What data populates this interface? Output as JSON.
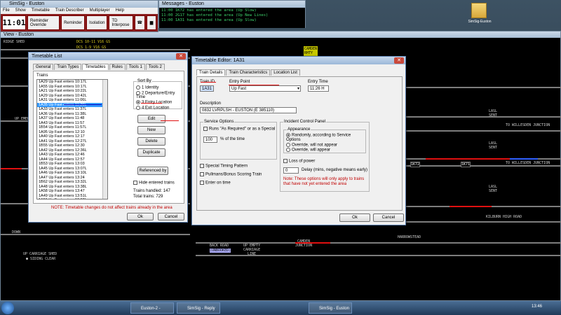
{
  "control": {
    "title": "SimSig - Euston",
    "menu": [
      "File",
      "Show",
      "Timetable",
      "Train Describer",
      "Multiplayer",
      "Help"
    ],
    "clock": "11:01",
    "buttons": [
      "Reminder Override",
      "Reminder",
      "Isolation",
      "TD Interpose"
    ]
  },
  "messages": {
    "title": "Messages - Euston",
    "lines": [
      "11:00 1K72 has entered the area (Up Slow)",
      "11:00 2G17 has entered the area (Up New Lines)",
      "11:00 1A31 has entered the area (Up Slow)"
    ]
  },
  "view": {
    "title": "View - Euston",
    "labels": {
      "sidings": "RIDGE SHED",
      "dcs1": "DCS 10-11 V16 GS",
      "dcs2": "DCS 1-9 V16 GS",
      "camden": "CAMDEN\nRHTY",
      "hillsden1": "TO WILLESDEN JUNCTION",
      "hillsden2": "TO WILLESDEN JUNCTION",
      "kilburn": "KILBURN HIGH ROAD",
      "down": "DOWN",
      "up_emerg": "UP EMERG",
      "up_carriage": "UP CARRIAGE SHED",
      "siding_clear": "● SIDING CLEAR",
      "back_road": "BACK ROAD",
      "unbooked": "(UNBOOKED)",
      "up_empty": "UP EMPTY\nCARRIAGE\nLINE",
      "camden_junction": "CAMDEN\nJUNCTION",
      "harrowsteads": "HARROWSTEAD",
      "lasl1": "LASL\nSENT",
      "lasl2": "LASL\nSENT",
      "lasl3": "LASL\nSENT",
      "td1": "1K72",
      "td2": "1K71"
    }
  },
  "timetable_list": {
    "title": "Timetable List",
    "tabs": [
      "General",
      "Train Types",
      "Timetables",
      "Rules",
      "Tools 1",
      "Tools 2"
    ],
    "trains_label": "Trains",
    "trains": [
      "1A29 Up Fast enters 10:17L",
      "1A55 Up Fast enters 10:17L",
      "1A21 Up Fast enters 10:22L",
      "1A29 Up Fast enters 10:42L",
      "1A31 Up Fast enters 11:06L",
      "1A35 Up Fast enters 11:26L",
      "1A33 Up Fast enters 11:37L",
      "1A36 Up Fast enters 11:38L",
      "1A37 Up Fast enters 11:48",
      "1A43 Up Fast enters 11:57",
      "1B54 Up Fast enters 11:57L",
      "1A95 Up Fast enters 12:10",
      "1A40 Up Fast enters 12:17",
      "1A41 Up Fast enters 12:27L",
      "1B55 Up Fast enters 12:30",
      "1A42 Up Fast enters 12:36L",
      "1A43 Up Fast enters 12:46",
      "1A44 Up Fast enters 12:57",
      "1B53 Up Fast enters 13:03",
      "1A45 Up Fast enters 13:07L",
      "1A46 Up Fast enters 13:10L",
      "1A47 Up Fast enters 13:24",
      "1B62 Up Fast enters 13:32L",
      "1A48 Up Fast enters 13:38L",
      "1A58 Up Fast enters 13:47",
      "1A49 Up Fast enters 13:51L",
      "1A51 Up Fast enters 13:58L",
      "1B58-2 Up Fast enters 14:00L",
      "1A53 Up Fast enters 14:12L",
      "1A54 Up Fast enters 14:15L"
    ],
    "selected_index": 5,
    "sort_by_label": "Sort By",
    "sort_options": [
      "1 Identity",
      "2 Departure/Entry Time",
      "3 Entry Location",
      "4 Exit Location"
    ],
    "sort_selected": 2,
    "edit": "Edit",
    "new": "New",
    "delete": "Delete",
    "duplicate": "Duplicate",
    "referenced_by": "Referenced by",
    "hide_entered": "Hide entered trains",
    "trains_handled": "Trains handled: 147",
    "total_trains": "Total trains: 729",
    "note": "NOTE: Timetable changes do not affect trains already in the area",
    "ok": "Ok",
    "cancel": "Cancel"
  },
  "timetable_editor": {
    "title": "Timetable Editor: 1A31",
    "tabs": [
      "Train Details",
      "Train Characteristics",
      "Location List"
    ],
    "train_id_label": "Train ID",
    "train_id": "1A31",
    "entry_point_label": "Entry Point",
    "entry_point": "Up Fast",
    "entry_time_label": "Entry Time",
    "entry_time": "11:26 H",
    "description_label": "Description",
    "description": "0832 LVRPLSH - EUSTON (E 385110)",
    "service_options_label": "Service Options",
    "runs_as_required": "Runs \"As Required\" or as a Special",
    "percent_value": "100",
    "percent_label": "% of the time",
    "special_timing": "Special Timing Pattern",
    "pullmans": "Pullmans/Bonus Scoring Train",
    "enter_on_time": "Enter on time",
    "incident_label": "Incident Control Panel",
    "appearance_label": "Appearance",
    "appearance_options": [
      "Randomly, according to Service Options",
      "Override, will not appear",
      "Override, will appear"
    ],
    "appearance_selected": 0,
    "loss_of_power": "Loss of power",
    "delay_value": "0",
    "delay_label": "Delay (mins, negative means early)",
    "note": "Note: These options will only apply to trains that have not yet entered the area",
    "ok": "Ok",
    "cancel": "Cancel"
  },
  "desktop": {
    "icon_label": "SimSig-Euston"
  },
  "taskbar": {
    "items": [
      "Euston-2 - Timeta...",
      "SimSig - Reply T...",
      "SimSig - Euston"
    ],
    "time": "13:46"
  }
}
